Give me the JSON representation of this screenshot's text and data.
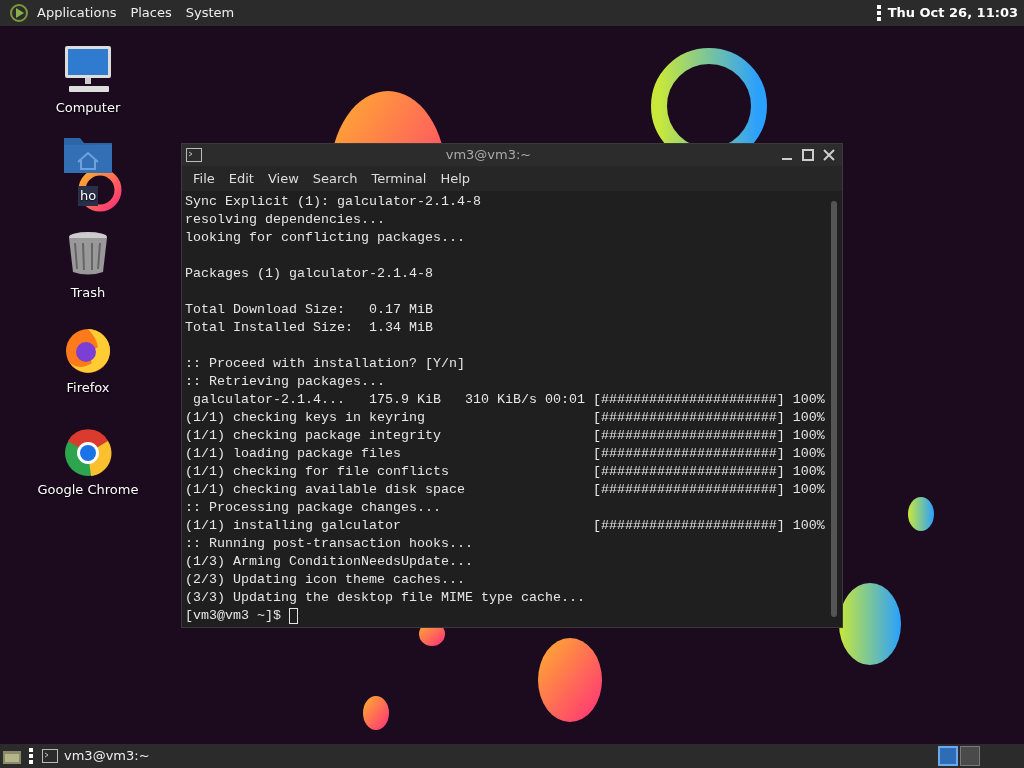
{
  "top_panel": {
    "menus": [
      {
        "label": "Applications"
      },
      {
        "label": "Places"
      },
      {
        "label": "System"
      }
    ],
    "clock": "Thu Oct 26, 11:03"
  },
  "desktop_icons": [
    {
      "label": "Computer",
      "kind": "computer"
    },
    {
      "label": "ho",
      "kind": "home"
    },
    {
      "label": "Trash",
      "kind": "trash"
    },
    {
      "label": "Firefox",
      "kind": "firefox"
    },
    {
      "label": "Google Chrome",
      "kind": "chrome"
    }
  ],
  "terminal": {
    "title": "vm3@vm3:~",
    "menu": [
      "File",
      "Edit",
      "View",
      "Search",
      "Terminal",
      "Help"
    ],
    "blocks": [
      [
        "Sync Explicit (1): galculator-2.1.4-8",
        "resolving dependencies...",
        "looking for conflicting packages..."
      ],
      [
        "Packages (1) galculator-2.1.4-8"
      ],
      [
        "Total Download Size:   0.17 MiB",
        "Total Installed Size:  1.34 MiB"
      ],
      [
        ":: Proceed with installation? [Y/n]",
        ":: Retrieving packages...",
        " galculator-2.1.4...   175.9 KiB   310 KiB/s 00:01 [######################] 100%",
        "(1/1) checking keys in keyring                     [######################] 100%",
        "(1/1) checking package integrity                   [######################] 100%",
        "(1/1) loading package files                        [######################] 100%",
        "(1/1) checking for file conflicts                  [######################] 100%",
        "(1/1) checking available disk space                [######################] 100%",
        ":: Processing package changes...",
        "(1/1) installing galculator                        [######################] 100%",
        ":: Running post-transaction hooks...",
        "(1/3) Arming ConditionNeedsUpdate...",
        "(2/3) Updating icon theme caches...",
        "(3/3) Updating the desktop file MIME type cache..."
      ]
    ],
    "prompt": "[vm3@vm3 ~]$"
  },
  "taskbar": {
    "tasks": [
      {
        "label": "vm3@vm3:~"
      }
    ],
    "workspaces": [
      {
        "selected": true
      },
      {
        "selected": false
      }
    ]
  }
}
